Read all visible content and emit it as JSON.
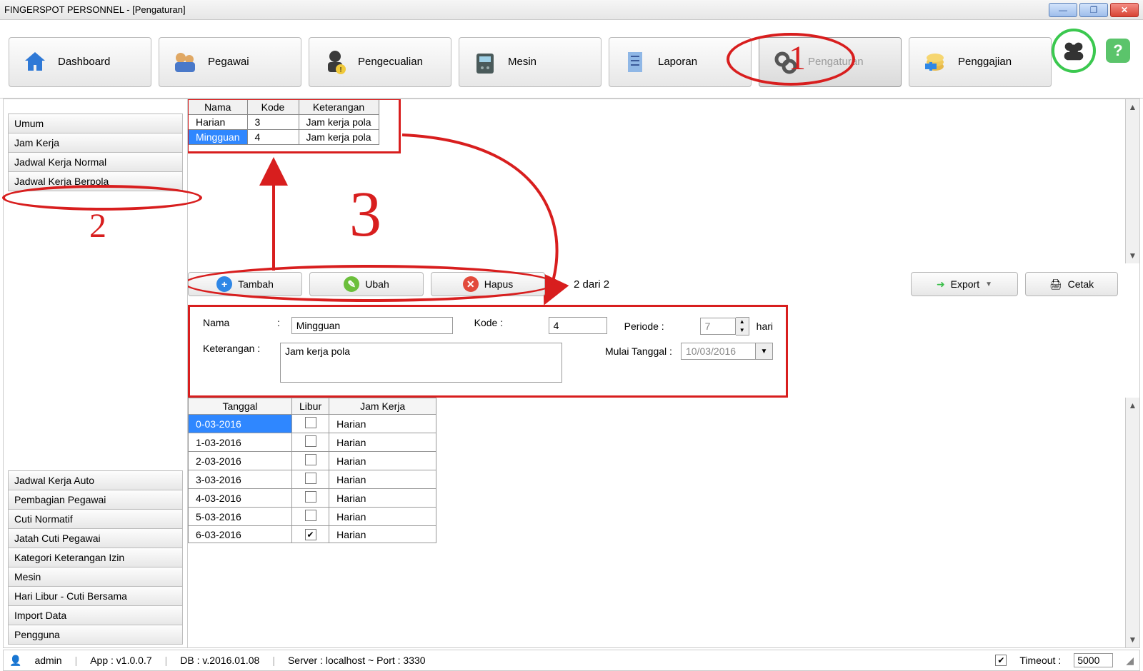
{
  "window": {
    "title": "FINGERSPOT PERSONNEL - [Pengaturan]"
  },
  "ribbon": {
    "tabs": {
      "dashboard": "Dashboard",
      "pegawai": "Pegawai",
      "pengecualian": "Pengecualian",
      "mesin": "Mesin",
      "laporan": "Laporan",
      "pengaturan": "Pengaturan",
      "penggajian": "Penggajian"
    }
  },
  "sidebar": {
    "top": {
      "umum": "Umum",
      "jam_kerja": "Jam Kerja",
      "jadwal_normal": "Jadwal Kerja Normal",
      "jadwal_berpola": "Jadwal Kerja Berpola"
    },
    "bottom": {
      "jadwal_auto": "Jadwal Kerja Auto",
      "pembagian": "Pembagian Pegawai",
      "cuti_normatif": "Cuti Normatif",
      "jatah_cuti": "Jatah Cuti Pegawai",
      "kategori_izin": "Kategori Keterangan Izin",
      "mesin": "Mesin",
      "hari_libur": "Hari Libur - Cuti Bersama",
      "import_data": "Import Data",
      "pengguna": "Pengguna"
    }
  },
  "pola_table": {
    "headers": {
      "nama": "Nama",
      "kode": "Kode",
      "keterangan": "Keterangan"
    },
    "rows": [
      {
        "nama": "Harian",
        "kode": "3",
        "keterangan": "Jam kerja pola"
      },
      {
        "nama": "Mingguan",
        "kode": "4",
        "keterangan": "Jam kerja pola"
      }
    ]
  },
  "toolbar": {
    "tambah": "Tambah",
    "ubah": "Ubah",
    "hapus": "Hapus",
    "count": "2 dari 2",
    "export": "Export",
    "cetak": "Cetak"
  },
  "form": {
    "nama_lbl": "Nama",
    "nama_val": "Mingguan",
    "kode_lbl": "Kode :",
    "kode_val": "4",
    "periode_lbl": "Periode :",
    "periode_val": "7",
    "periode_unit": "hari",
    "keterangan_lbl": "Keterangan :",
    "keterangan_val": "Jam kerja pola",
    "mulai_lbl": "Mulai Tanggal :",
    "mulai_val": "10/03/2016"
  },
  "schedule": {
    "headers": {
      "tanggal": "Tanggal",
      "libur": "Libur",
      "jam_kerja": "Jam Kerja"
    },
    "rows": [
      {
        "tanggal": "0-03-2016",
        "libur": false,
        "jam_kerja": "Harian",
        "selected": true
      },
      {
        "tanggal": "1-03-2016",
        "libur": false,
        "jam_kerja": "Harian"
      },
      {
        "tanggal": "2-03-2016",
        "libur": false,
        "jam_kerja": "Harian"
      },
      {
        "tanggal": "3-03-2016",
        "libur": false,
        "jam_kerja": "Harian"
      },
      {
        "tanggal": "4-03-2016",
        "libur": false,
        "jam_kerja": "Harian"
      },
      {
        "tanggal": "5-03-2016",
        "libur": false,
        "jam_kerja": "Harian"
      },
      {
        "tanggal": "6-03-2016",
        "libur": true,
        "jam_kerja": "Harian"
      }
    ]
  },
  "status": {
    "user": "admin",
    "app": "App : v1.0.0.7",
    "db": "DB : v.2016.01.08",
    "server": "Server : localhost ~ Port : 3330",
    "timeout_lbl": "Timeout :",
    "timeout_val": "5000"
  },
  "annotations": {
    "n1": "1",
    "n2": "2",
    "n3": "3"
  }
}
